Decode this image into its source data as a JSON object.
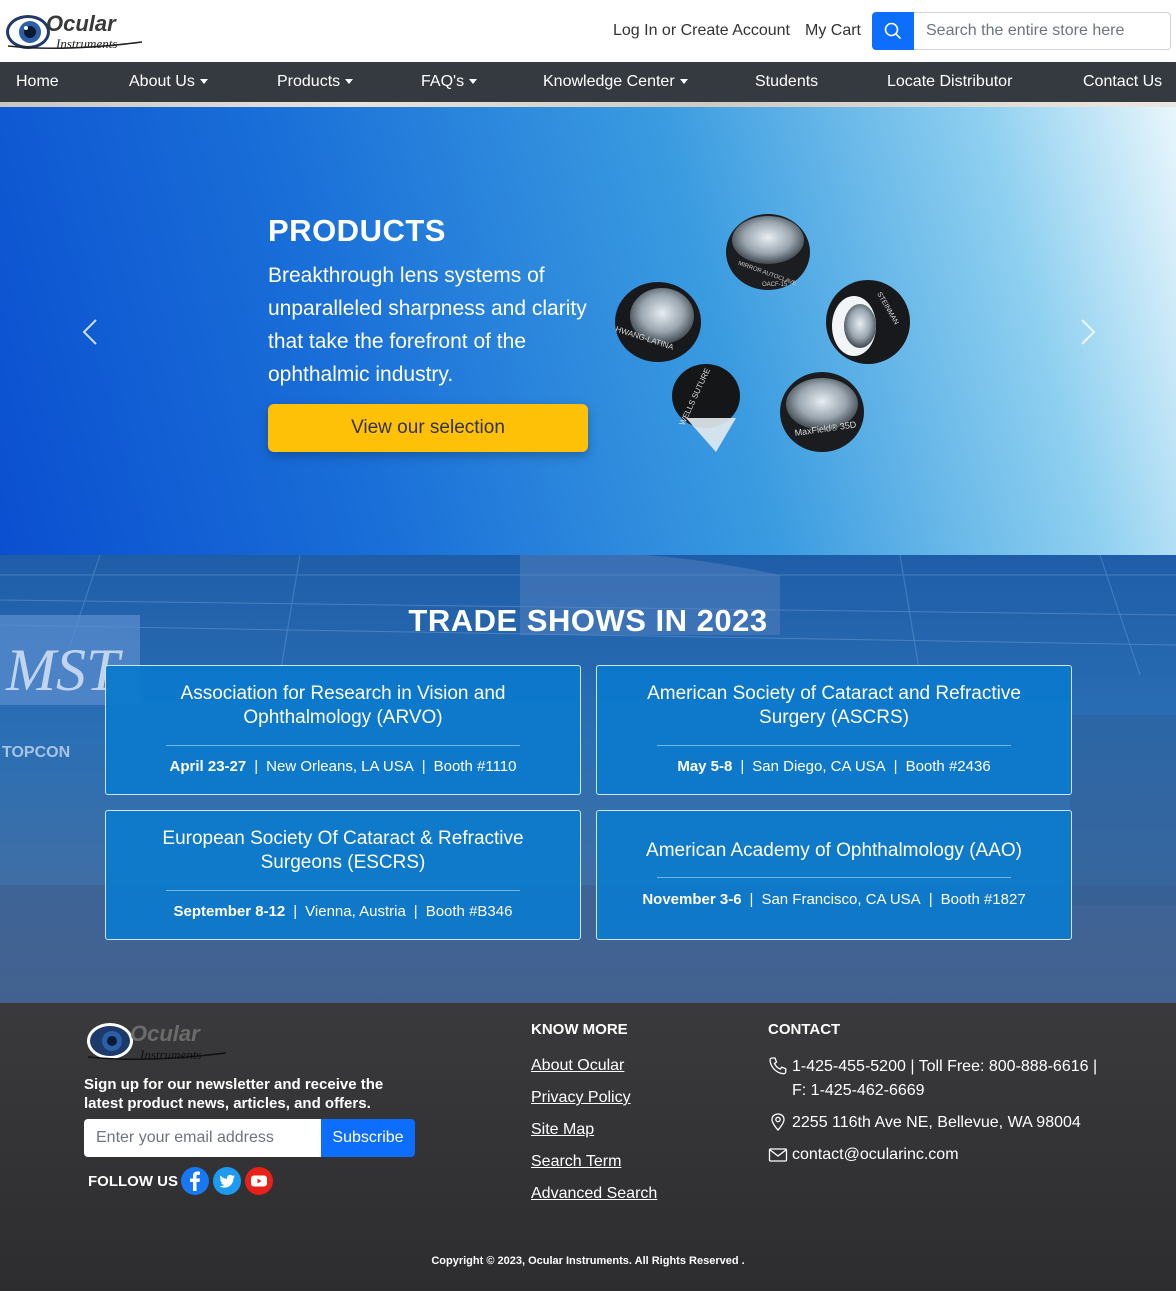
{
  "header": {
    "logo_text": "Ocular",
    "logo_subtext": "Instruments",
    "login_label": "Log In or Create Account",
    "cart_label": "My Cart",
    "search_placeholder": "Search the entire store here"
  },
  "nav": {
    "items": [
      {
        "label": "Home",
        "dropdown": false
      },
      {
        "label": "About Us",
        "dropdown": true
      },
      {
        "label": "Products",
        "dropdown": true
      },
      {
        "label": "FAQ's",
        "dropdown": true
      },
      {
        "label": "Knowledge Center",
        "dropdown": true
      },
      {
        "label": "Students",
        "dropdown": false
      },
      {
        "label": "Locate Distributor",
        "dropdown": false
      },
      {
        "label": "Contact Us",
        "dropdown": false
      }
    ]
  },
  "hero": {
    "title": "PRODUCTS",
    "text": "Breakthrough lens systems of unparalleled sharpness and clarity that take the forefront of the ophthalmic industry.",
    "button_label": "View our selection",
    "lens_labels": [
      "MIRROR AUTOCLAVE",
      "OACF-15",
      "HWANG-LATINA",
      "STEINMAN",
      "WELLS SUTURE",
      "MaxField® 35D"
    ]
  },
  "shows": {
    "title": "TRADE SHOWS IN 2023",
    "booth_banners": [
      "MST",
      "TOPCON"
    ],
    "cards": [
      {
        "name": "Association for Research in Vision and Ophthalmology (ARVO)",
        "dates": "April 23-27",
        "location": "New Orleans, LA USA",
        "booth": "Booth #1110"
      },
      {
        "name": "American Society of Cataract and Refractive Surgery (ASCRS)",
        "dates": "May 5-8",
        "location": "San Diego, CA USA",
        "booth": "Booth #2436"
      },
      {
        "name": "European Society Of Cataract & Refractive Surgeons (ESCRS)",
        "dates": "September 8-12",
        "location": "Vienna, Austria",
        "booth": "Booth #B346"
      },
      {
        "name": "American Academy of Ophthalmology (AAO)",
        "dates": "November 3-6",
        "location": "San Francisco, CA USA",
        "booth": "Booth #1827"
      }
    ]
  },
  "footer": {
    "newsletter_text": "Sign up for our newsletter and receive the latest product news, articles, and offers.",
    "email_placeholder": "Enter your email address",
    "subscribe_label": "Subscribe",
    "follow_label": "FOLLOW US",
    "social_icons": [
      "facebook-icon",
      "twitter-icon",
      "youtube-icon"
    ],
    "know_more_heading": "KNOW MORE",
    "links": [
      "About Ocular",
      "Privacy Policy",
      "Site Map",
      "Search Term",
      "Advanced Search"
    ],
    "contact_heading": "CONTACT",
    "phone_line1": "1-425-455-5200 | Toll Free: 800-888-6616 |",
    "phone_line2": "F: 1-425-462-6669",
    "address": "2255 116th Ave NE, Bellevue, WA 98004",
    "email": "contact@ocularinc.com",
    "copyright": "Copyright © 2023, Ocular Instruments. All Rights Reserved ."
  },
  "colors": {
    "nav_bg": "#343a40",
    "accent_blue": "#0d6efd",
    "cta_yellow": "#ffc107",
    "card_blue": "#0c7acc",
    "footer_bg": "#333335"
  }
}
